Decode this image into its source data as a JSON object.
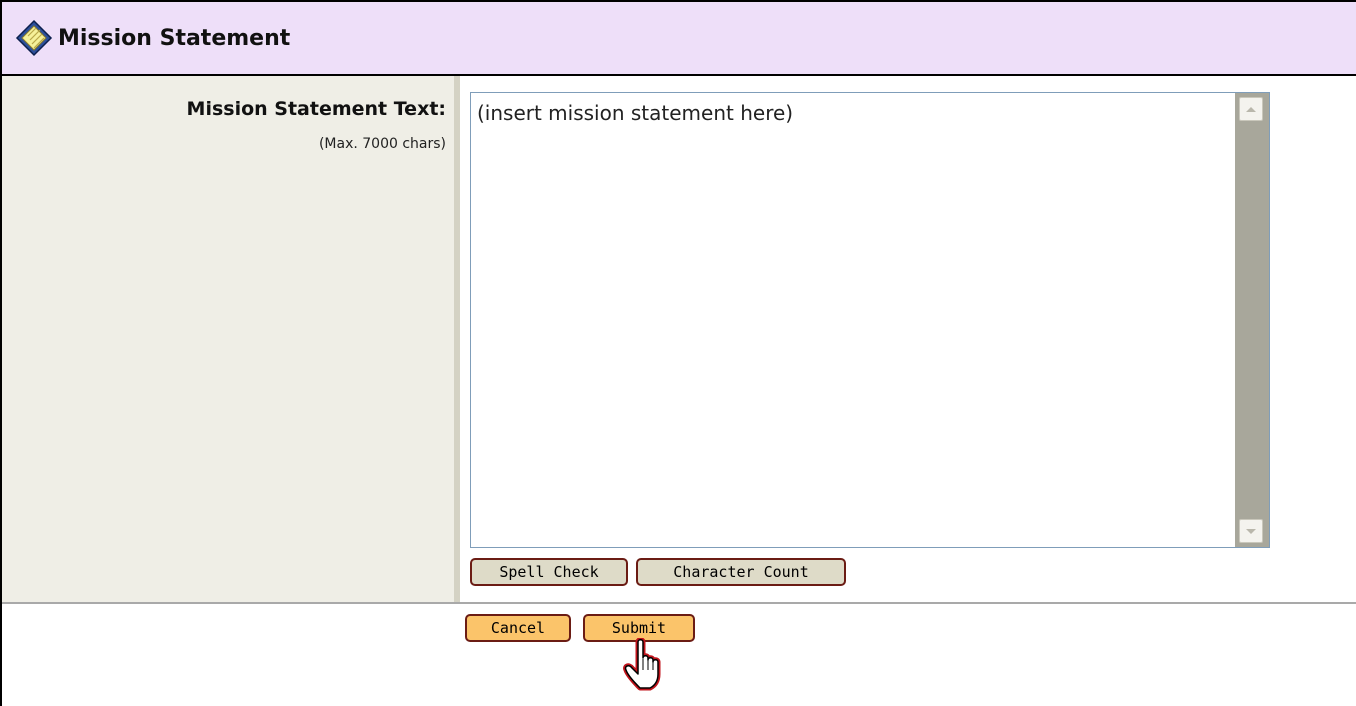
{
  "header": {
    "title": "Mission Statement",
    "icon": "diamond-icon"
  },
  "form": {
    "field_label": "Mission Statement Text:",
    "field_hint": "(Max. 7000 chars)",
    "textarea_value": "(insert mission statement here)",
    "spell_check_label": "Spell Check",
    "character_count_label": "Character Count"
  },
  "actions": {
    "cancel_label": "Cancel",
    "submit_label": "Submit"
  },
  "colors": {
    "header_bg": "#eedff9",
    "label_bg": "#efeee6",
    "button_gray": "#dedbc8",
    "button_orange": "#fbc46a",
    "button_border": "#6b1c14"
  },
  "cursor_icon": "hand-pointer-icon"
}
